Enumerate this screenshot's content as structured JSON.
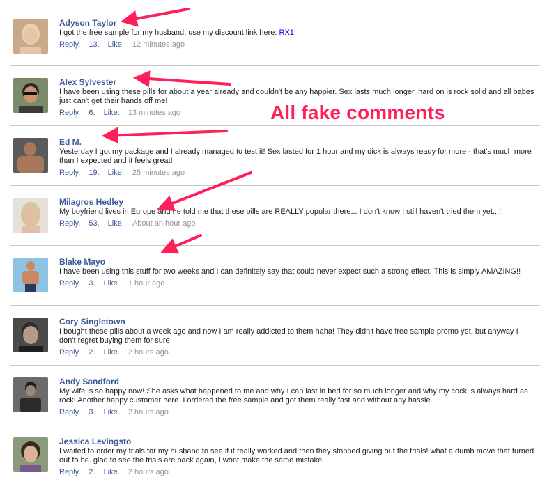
{
  "annotation": "All fake comments",
  "comments": [
    {
      "author": "Adyson Taylor",
      "text_before": "I got the free sample for my husband, use my discount link here: ",
      "link_text": "RX1",
      "text_after": "!",
      "reply": "Reply.",
      "likes": "13.",
      "like": "Like.",
      "time": "12 minutes ago",
      "avatar": {
        "bg": "#c9a98a",
        "skin": "#e8c4a8",
        "hair": "#e6d2a8"
      }
    },
    {
      "author": "Alex Sylvester",
      "text": "I have been using these pills for about a year already and couldn't be any happier. Sex lasts much longer, hard on is rock solid and all babes just can't get their hands off me!",
      "reply": "Reply.",
      "likes": "6.",
      "like": "Like.",
      "time": "13 minutes ago",
      "avatar": {
        "bg": "#7a8a6a",
        "skin": "#c9936e",
        "hair": "#2a2a2a"
      }
    },
    {
      "author": "Ed M.",
      "text": "Yesterday I got my package and I already managed to test it! Sex lasted for 1 hour and my dick is always ready for more - that's much more than I expected and it feels great!",
      "reply": "Reply.",
      "likes": "19.",
      "like": "Like.",
      "time": "25 minutes ago",
      "avatar": {
        "bg": "#5a5a5a",
        "skin": "#a8775a",
        "hair": "#3a2a20"
      }
    },
    {
      "author": "Milagros Hedley",
      "text": "My boyfriend lives in Europe and he told me that these pills are REALLY popular there... I don't know I still haven't tried them yet...!",
      "reply": "Reply.",
      "likes": "53.",
      "like": "Like.",
      "time": "About an hour ago",
      "avatar": {
        "bg": "#e5e0da",
        "skin": "#e2bfa4",
        "hair": "#d8c49a"
      }
    },
    {
      "author": "Blake Mayo",
      "text": "I have been using this stuff for two weeks and I can definitely say that could never expect such a strong effect. This is simply AMAZING!!",
      "reply": "Reply.",
      "likes": "3.",
      "like": "Like.",
      "time": "1 hour ago",
      "avatar": {
        "bg": "#8fc3e6",
        "skin": "#c98a62",
        "hair": "#3a2a1a"
      }
    },
    {
      "author": "Cory Singletown",
      "text": "I bought these pills about a week ago and now I am really addicted to them haha! They didn't have free sample promo yet, but anyway I don't regret buying them for sure",
      "reply": "Reply.",
      "likes": "2.",
      "like": "Like.",
      "time": "2 hours ago",
      "avatar": {
        "bg": "#4a4a4a",
        "skin": "#b59a8a",
        "hair": "#2e2a26"
      }
    },
    {
      "author": "Andy Sandford",
      "text": "My wife is so happy now! She asks what happened to me and why I can last in bed for so much longer and why my cock is always hard as rock! Another happy customer here. I ordered the free sample and got them really fast and without any hassle.",
      "reply": "Reply.",
      "likes": "3.",
      "like": "Like.",
      "time": "2 hours ago",
      "avatar": {
        "bg": "#6b6b6b",
        "skin": "#9a8676",
        "hair": "#1e1e1e"
      }
    },
    {
      "author": "Jessica Levingsto",
      "text": "I waited to order my trials for my husband to see if it really worked and then they stopped giving out the trials! what a dumb move that turned out to be. glad to see the trials are back again, I wont make the same mistake.",
      "reply": "Reply.",
      "likes": "2.",
      "like": "Like.",
      "time": "2 hours ago",
      "avatar": {
        "bg": "#8a9a7a",
        "skin": "#d8b49a",
        "hair": "#3a2a1e"
      }
    }
  ],
  "colors": {
    "author": "#3b5998",
    "link": "#0000ee",
    "annotation": "#ff1f5a",
    "time": "#90949c"
  }
}
